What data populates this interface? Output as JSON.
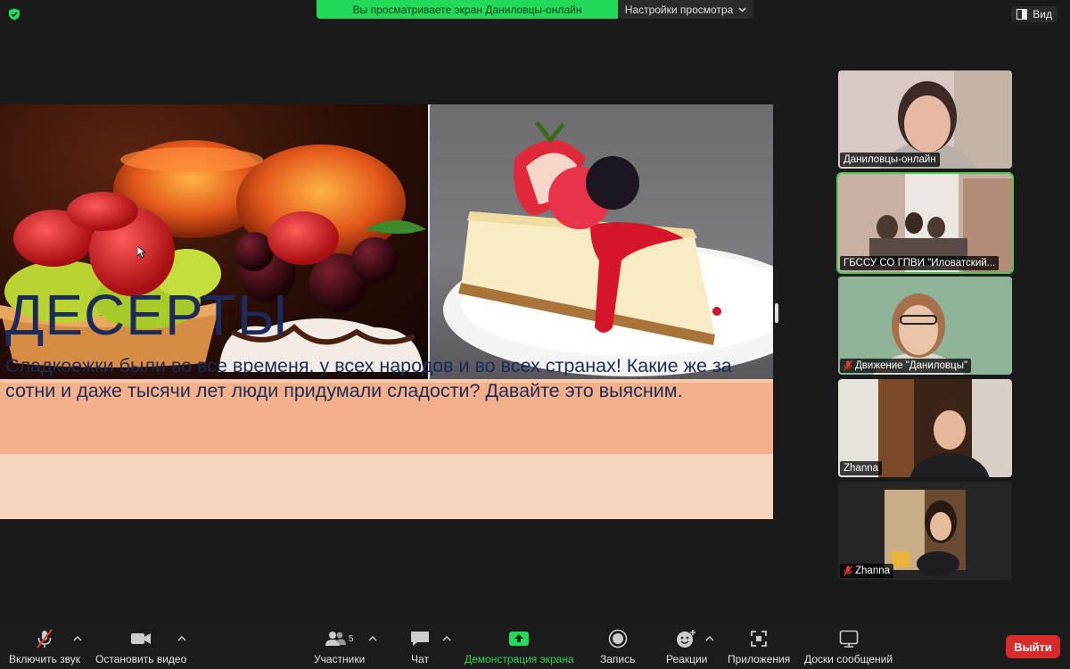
{
  "top": {
    "share_text": "Вы просматриваете экран Даниловцы-онлайн",
    "view_options_label": "Настройки просмотра",
    "view_label": "Вид"
  },
  "slide": {
    "title": "ДЕСЕРТЫ",
    "body": "Сладкоежки были во все временя, у всех народов и во всех странах! Какие же за сотни и даже тысячи лет люди придумали сладости? Давайте это выясним."
  },
  "participants": [
    {
      "name": "Даниловцы-онлайн",
      "muted": false,
      "active": false
    },
    {
      "name": "ГБССУ СО ГПВИ \"Иловатский...",
      "muted": false,
      "active": true
    },
    {
      "name": "Движение \"Даниловцы\"",
      "muted": true,
      "active": false
    },
    {
      "name": "Zhanna",
      "muted": false,
      "active": false
    },
    {
      "name": "Zhanna",
      "muted": true,
      "active": false
    }
  ],
  "toolbar": {
    "unmute_label": "Включить звук",
    "stop_video_label": "Остановить видео",
    "participants_label": "Участники",
    "participants_count": "5",
    "chat_label": "Чат",
    "share_label": "Демонстрация экрана",
    "record_label": "Запись",
    "reactions_label": "Реакции",
    "apps_label": "Приложения",
    "whiteboards_label": "Доски сообщений",
    "exit_label": "Выйти"
  },
  "colors": {
    "share_green": "#23d959",
    "exit_red": "#d92b2b",
    "slide_title": "#1c2b5a",
    "active_outline": "#4ecb4e"
  }
}
